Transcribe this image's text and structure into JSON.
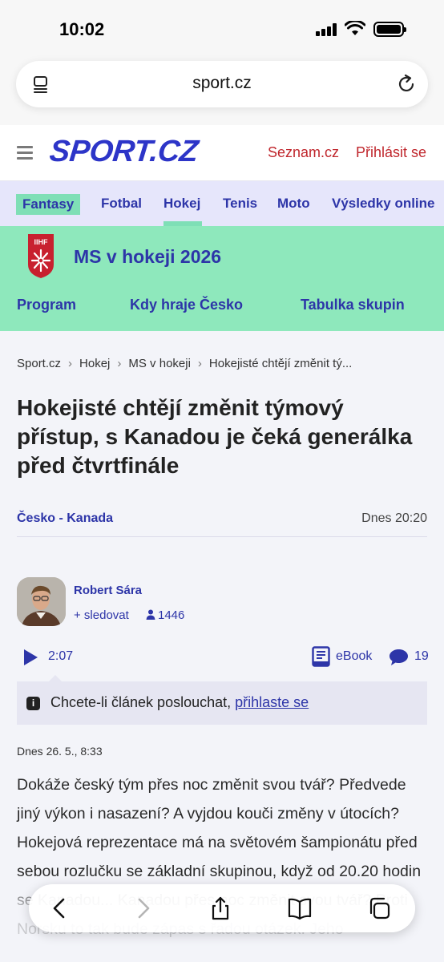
{
  "status_bar": {
    "time": "10:02"
  },
  "browser": {
    "url": "sport.cz"
  },
  "header": {
    "logo": "SPORT.CZ",
    "seznam_link": "Seznam.cz",
    "login_link": "Přihlásit se"
  },
  "nav": {
    "items": [
      "Fantasy",
      "Fotbal",
      "Hokej",
      "Tenis",
      "Moto",
      "Výsledky online"
    ],
    "active": "Hokej"
  },
  "banner": {
    "emblem_text": "IIHF",
    "title": "MS v hokeji 2026",
    "links": [
      "Program",
      "Kdy hraje Česko",
      "Tabulka skupin"
    ]
  },
  "breadcrumb": [
    "Sport.cz",
    "Hokej",
    "MS v hokeji",
    "Hokejisté chtějí změnit tý..."
  ],
  "article": {
    "headline": "Hokejisté chtějí změnit týmový přístup, s Kanadou je čeká generálka před čtvrtfinále",
    "tag": "Česko - Kanada",
    "time": "Dnes 20:20",
    "author": {
      "name": "Robert Sára",
      "follow_label": "+ sledovat",
      "followers": "1446"
    },
    "audio": {
      "duration": "2:07"
    },
    "ebook_label": "eBook",
    "comments_count": "19",
    "listen_prompt": "Chcete-li článek poslouchat, ",
    "listen_link": "přihlaste se",
    "date": "Dnes 26. 5., 8:33",
    "body": "Dokáže český tým přes noc změnit svou tvář? Předvede jiný výkon i nasazení? A vyjdou kouči změny v útocích? Hokejová reprezentace má na světovém šampionátu před sebou rozlučku se základní skupinou, když od 20.20 hodin se Kanadou... Kanadou přes noc změnit svou tvář? Proti Norsku to tak bude zápas s řadou otázek. Jeho"
  },
  "colors": {
    "brand_blue": "#2d35c8",
    "accent_green": "#8ee8bc",
    "link_red": "#c0272d"
  }
}
